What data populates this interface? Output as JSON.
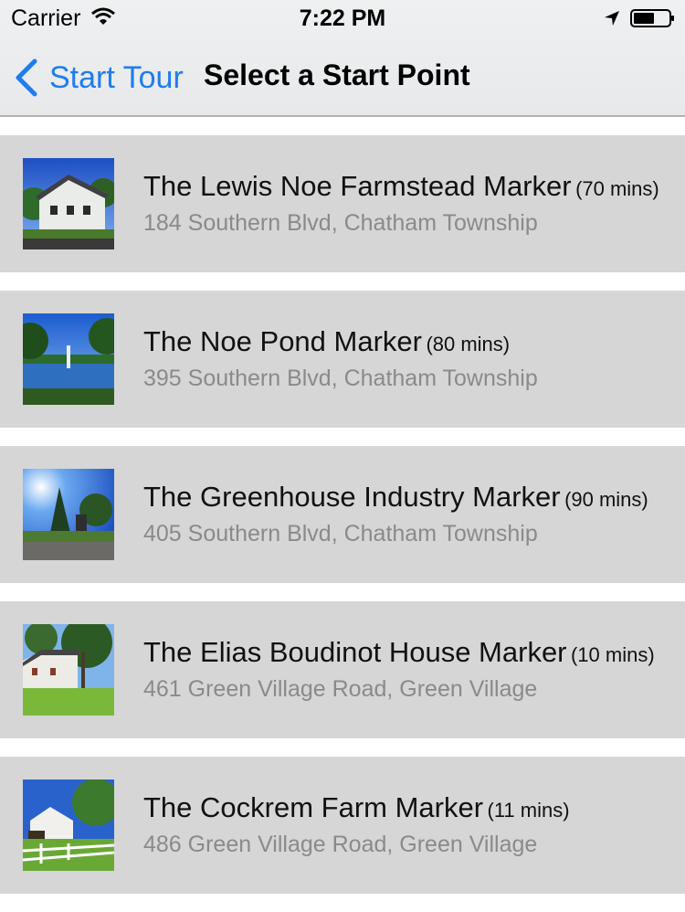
{
  "status_bar": {
    "carrier": "Carrier",
    "time": "7:22 PM",
    "icons": [
      "wifi-icon",
      "location-arrow-icon",
      "battery-icon"
    ]
  },
  "nav": {
    "back_label": "Start Tour",
    "title": "Select a Start Point",
    "accent_color": "#1f7cf0"
  },
  "colors": {
    "row_background": "#d6d6d6",
    "address_text": "#8a8a8a"
  },
  "markers": [
    {
      "title": "The Lewis Noe Farmstead Marker",
      "duration": "(70 mins)",
      "address": "184 Southern Blvd, Chatham Township",
      "thumbnail": "farmstead-photo"
    },
    {
      "title": "The Noe Pond Marker",
      "duration": "(80 mins)",
      "address": "395 Southern Blvd, Chatham Township",
      "thumbnail": "pond-photo"
    },
    {
      "title": "The Greenhouse Industry Marker",
      "duration": "(90 mins)",
      "address": "405 Southern Blvd, Chatham Township",
      "thumbnail": "greenhouse-photo"
    },
    {
      "title": "The Elias Boudinot House Marker",
      "duration": "(10 mins)",
      "address": "461 Green Village Road, Green Village",
      "thumbnail": "house-photo"
    },
    {
      "title": "The Cockrem Farm Marker",
      "duration": "(11 mins)",
      "address": "486 Green Village Road, Green Village",
      "thumbnail": "farm-photo"
    }
  ]
}
